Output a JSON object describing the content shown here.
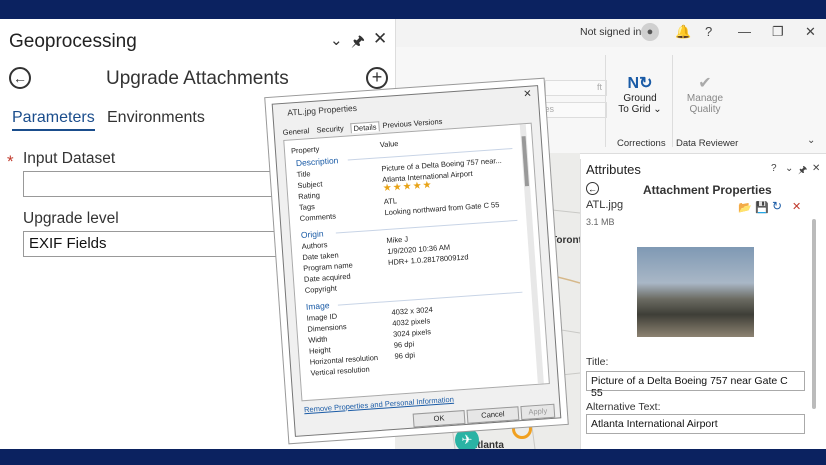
{
  "topbar": {
    "sign_in": "Not signed in",
    "help": "?"
  },
  "ribbon": {
    "field_1": "ft",
    "field_2": "ces",
    "ground_to_grid": "Ground",
    "ground_to_grid_2": "To Grid",
    "manage_quality": "Manage",
    "manage_quality_2": "Quality",
    "group_corrections": "Corrections",
    "group_reviewer": "Data Reviewer",
    "group_left": "n"
  },
  "geo": {
    "title": "Geoprocessing",
    "tool": "Upgrade Attachments",
    "tabs": [
      "Parameters",
      "Environments"
    ],
    "input_label": "Input Dataset",
    "input_value": "",
    "level_label": "Upgrade level",
    "level_value": "EXIF Fields"
  },
  "map": {
    "city_1": "Toront",
    "city_2": "Atlanta"
  },
  "attr": {
    "title": "Attributes",
    "sub": "Attachment Properties",
    "fname": "ATL.jpg",
    "fsize": "3.1 MB",
    "title_label": "Title:",
    "title_value": "Picture of a Delta Boeing 757 near Gate C 55",
    "alt_label": "Alternative Text:",
    "alt_value": "Atlanta International Airport"
  },
  "dialog": {
    "title": "ATL.jpg Properties",
    "tabs": [
      "General",
      "Security",
      "Details",
      "Previous Versions"
    ],
    "col_property": "Property",
    "col_value": "Value",
    "sections": {
      "description": "Description",
      "origin": "Origin",
      "image": "Image"
    },
    "rows": {
      "title": [
        "Title",
        "Picture of a Delta Boeing 757 near..."
      ],
      "subject": [
        "Subject",
        "Atlanta International Airport"
      ],
      "rating": [
        "Rating",
        "★★★★★"
      ],
      "tags": [
        "Tags",
        "ATL"
      ],
      "comments": [
        "Comments",
        "Looking northward from Gate C 55"
      ],
      "authors": [
        "Authors",
        "Mike J"
      ],
      "date_taken": [
        "Date taken",
        "1/9/2020 10:36 AM"
      ],
      "program": [
        "Program name",
        "HDR+ 1.0.281780091zd"
      ],
      "acquired": [
        "Date acquired",
        ""
      ],
      "copyright": [
        "Copyright",
        ""
      ],
      "image_id": [
        "Image ID",
        "4032 x 3024"
      ],
      "dimensions": [
        "Dimensions",
        "4032 pixels"
      ],
      "width": [
        "Width",
        "3024 pixels"
      ],
      "height": [
        "Height",
        "96 dpi"
      ],
      "hres": [
        "Horizontal resolution",
        "96 dpi"
      ],
      "vres": [
        "Vertical resolution",
        ""
      ]
    },
    "link": "Remove Properties and Personal Information",
    "ok": "OK",
    "cancel": "Cancel",
    "apply": "Apply"
  }
}
